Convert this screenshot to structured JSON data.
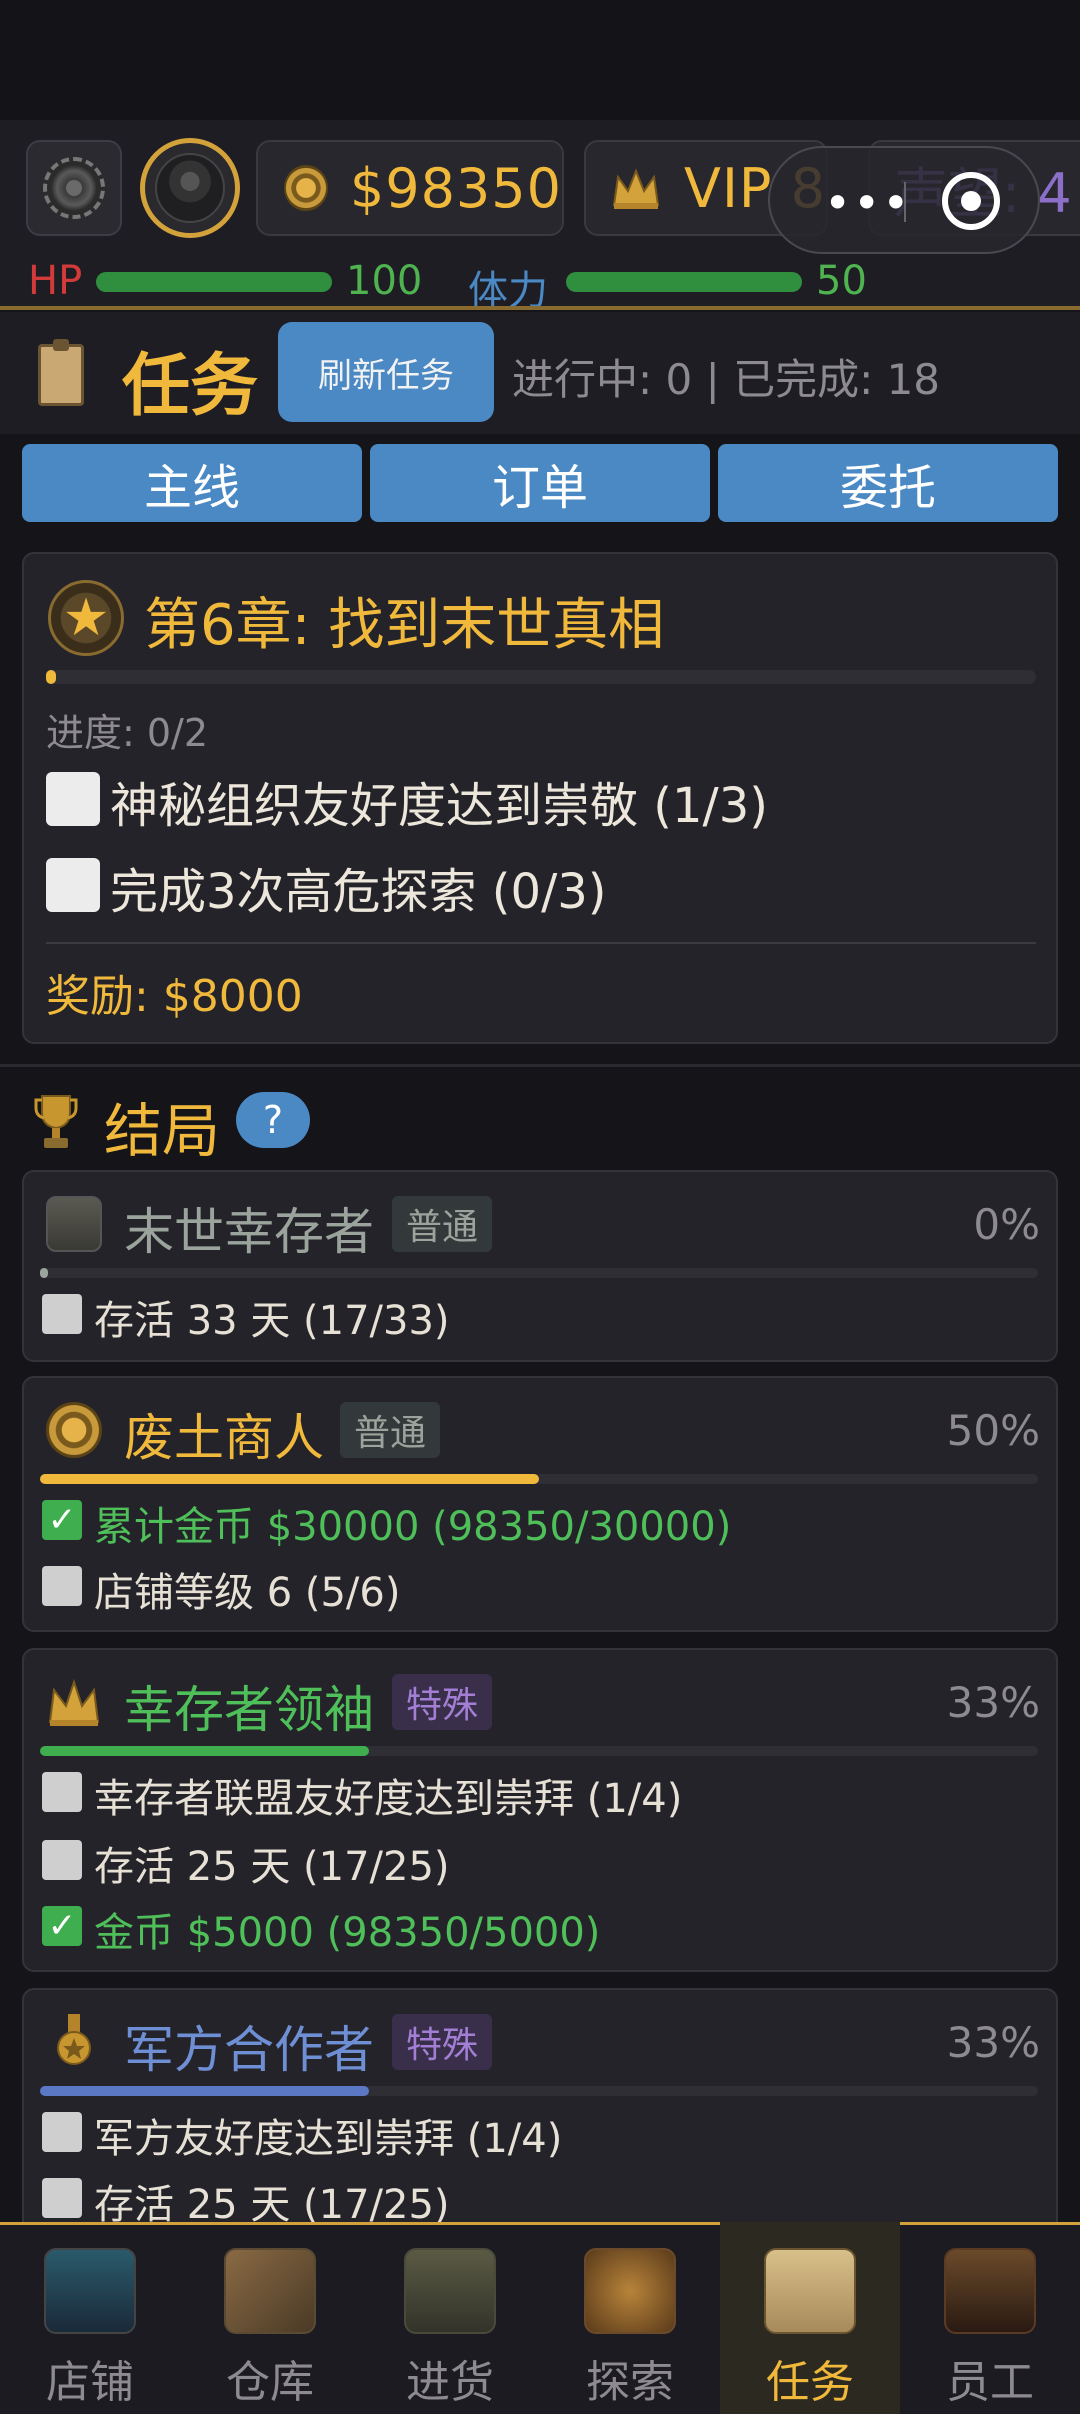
{
  "hud": {
    "coins": "$98350",
    "vip": "VIP 8",
    "reputation": "声望: 4",
    "hp_label": "HP",
    "hp_value": "100",
    "hp_fraction": 1.0,
    "stamina_label": "体力",
    "stamina_value": "50",
    "stamina_fraction": 1.0
  },
  "task_header": {
    "title": "任务",
    "refresh_label": "刷新任务",
    "status": "进行中: 0 | 已完成: 18"
  },
  "tabs": [
    "主线",
    "订单",
    "委托"
  ],
  "chapter": {
    "title": "第6章: 找到末世真相",
    "progress_label": "进度: 0/2",
    "progress_fraction": 0.0,
    "objectives": [
      "神秘组织友好度达到崇敬 (1/3)",
      "完成3次高危探索 (0/3)"
    ],
    "reward": "奖励: $8000"
  },
  "endings": {
    "title": "结局",
    "help": "?",
    "cards": [
      {
        "title": "末世幸存者",
        "badge": "普通",
        "percent": "0%",
        "title_color": "#9aa49c",
        "bar_color": "#9aa49c",
        "fraction": 0.0,
        "objectives": [
          {
            "text": "存活 33 天 (17/33)",
            "done": false
          }
        ]
      },
      {
        "title": "废土商人",
        "badge": "普通",
        "percent": "50%",
        "title_color": "#f0b93c",
        "bar_color": "#f0b93c",
        "fraction": 0.5,
        "objectives": [
          {
            "text": "累计金币 $30000 (98350/30000)",
            "done": true
          },
          {
            "text": "店铺等级 6 (5/6)",
            "done": false
          }
        ]
      },
      {
        "title": "幸存者领袖",
        "badge": "特殊",
        "percent": "33%",
        "title_color": "#4fbf5a",
        "bar_color": "#3fae4f",
        "fraction": 0.33,
        "objectives": [
          {
            "text": "幸存者联盟友好度达到崇拜 (1/4)",
            "done": false
          },
          {
            "text": "存活 25 天 (17/25)",
            "done": false
          },
          {
            "text": "金币 $5000 (98350/5000)",
            "done": true
          }
        ]
      },
      {
        "title": "军方合作者",
        "badge": "特殊",
        "percent": "33%",
        "title_color": "#6f8fd4",
        "bar_color": "#5a78c4",
        "fraction": 0.33,
        "objectives": [
          {
            "text": "军方友好度达到崇拜 (1/4)",
            "done": false
          },
          {
            "text": "存活 25 天 (17/25)",
            "done": false
          }
        ]
      }
    ]
  },
  "nav": [
    {
      "label": "店铺",
      "icon": "shop-icon",
      "active": false
    },
    {
      "label": "仓库",
      "icon": "warehouse-crate-icon",
      "active": false
    },
    {
      "label": "进货",
      "icon": "truck-icon",
      "active": false
    },
    {
      "label": "探索",
      "icon": "map-icon",
      "active": false
    },
    {
      "label": "任务",
      "icon": "task-clipboard-icon",
      "active": true
    },
    {
      "label": "员工",
      "icon": "staff-icon",
      "active": false
    }
  ],
  "colors": {
    "accent_gold": "#f0b93c",
    "tab_blue": "#4a89c4",
    "hp_label": "#d33a3a",
    "stamina_label": "#4a89c4",
    "bar_green": "#2f8f3e"
  }
}
